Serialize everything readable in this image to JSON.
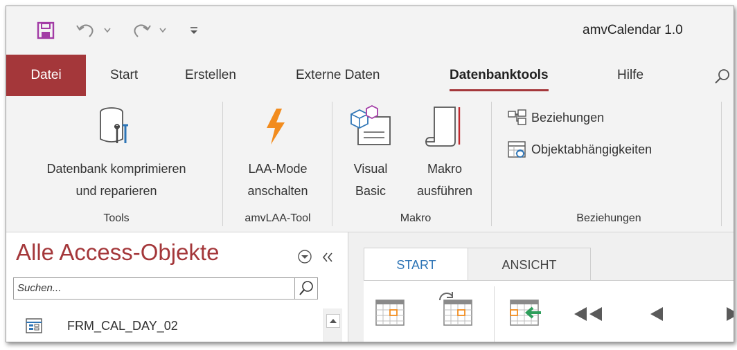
{
  "app": {
    "title": "amvCalendar 1.0"
  },
  "tabs": [
    {
      "label": "Datei"
    },
    {
      "label": "Start"
    },
    {
      "label": "Erstellen"
    },
    {
      "label": "Externe Daten"
    },
    {
      "label": "Datenbanktools"
    },
    {
      "label": "Hilfe"
    }
  ],
  "ribbon": {
    "groups": {
      "tools": {
        "title": "Tools",
        "btn_line1": "Datenbank komprimieren",
        "btn_line2": "und reparieren"
      },
      "laa": {
        "title": "amvLAA-Tool",
        "btn_line1": "LAA-Mode",
        "btn_line2": "anschalten"
      },
      "makro": {
        "title": "Makro",
        "vb_line1": "Visual",
        "vb_line2": "Basic",
        "run_line1": "Makro",
        "run_line2": "ausführen"
      },
      "beziehungen": {
        "title": "Beziehungen",
        "btn1": "Beziehungen",
        "btn2": "Objektabhängigkeiten"
      }
    }
  },
  "nav": {
    "title": "Alle Access-Objekte",
    "search_placeholder": "Suchen...",
    "items": [
      {
        "label": "FRM_CAL_DAY_02"
      }
    ]
  },
  "form": {
    "tabs": [
      {
        "label": "START"
      },
      {
        "label": "ANSICHT"
      }
    ]
  },
  "colors": {
    "accent": "#a4373a",
    "tab_active_text": "#2e75b6",
    "lightning": "#f28c1e"
  }
}
